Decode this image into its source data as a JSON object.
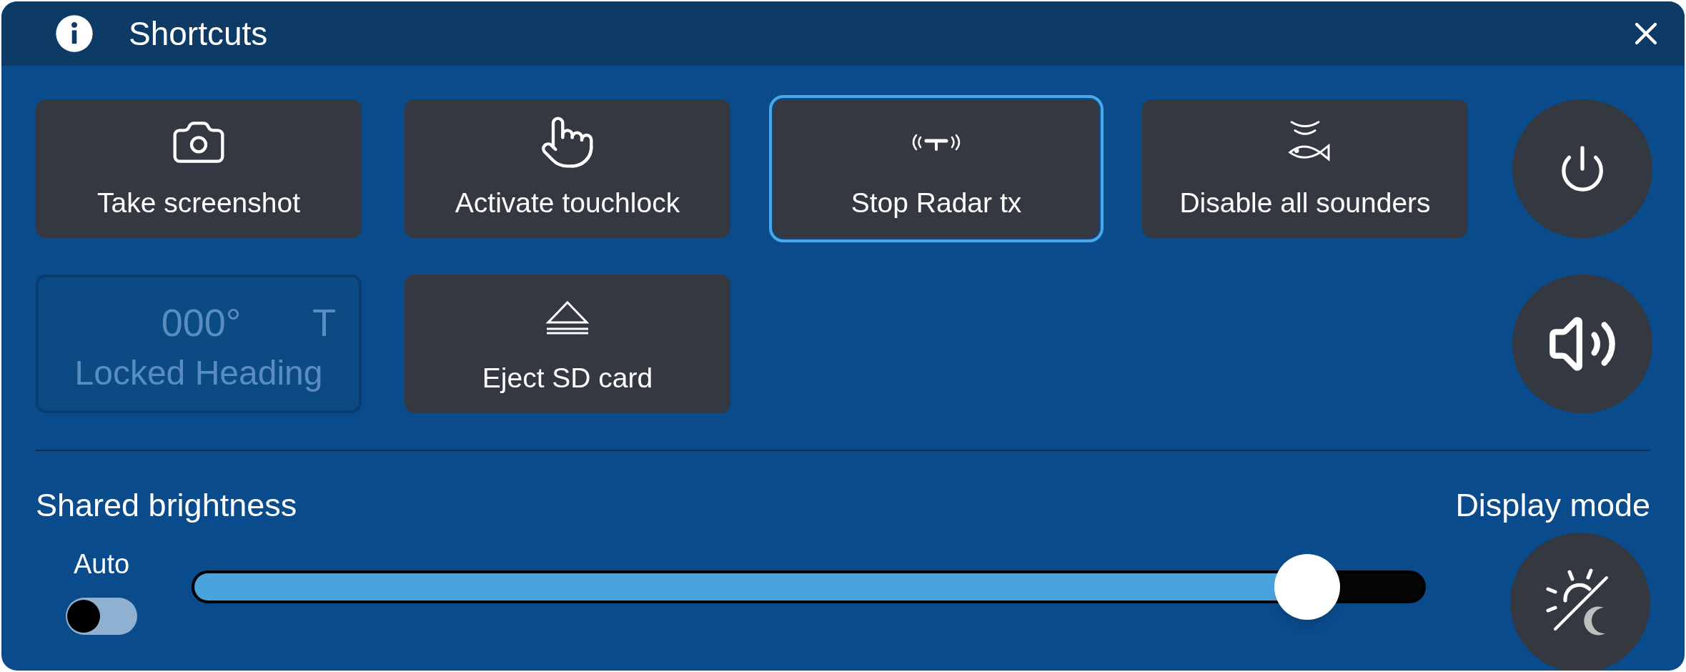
{
  "window": {
    "title": "Shortcuts"
  },
  "shortcuts": [
    {
      "kind": "camera",
      "label": "Take screenshot",
      "selected": false
    },
    {
      "kind": "touch",
      "label": "Activate touchlock",
      "selected": false
    },
    {
      "kind": "radar",
      "label": "Stop Radar tx",
      "selected": true
    },
    {
      "kind": "sounder",
      "label": "Disable all sounders",
      "selected": false
    },
    {
      "kind": "heading",
      "value": "000°",
      "reference": "T",
      "label": "Locked Heading",
      "disabled": true,
      "selected": false
    },
    {
      "kind": "eject",
      "label": "Eject SD card",
      "selected": false
    }
  ],
  "brightness": {
    "label": "Shared brightness",
    "auto_label": "Auto",
    "auto": false,
    "level": 0.906
  },
  "display_mode": {
    "label": "Display mode"
  }
}
